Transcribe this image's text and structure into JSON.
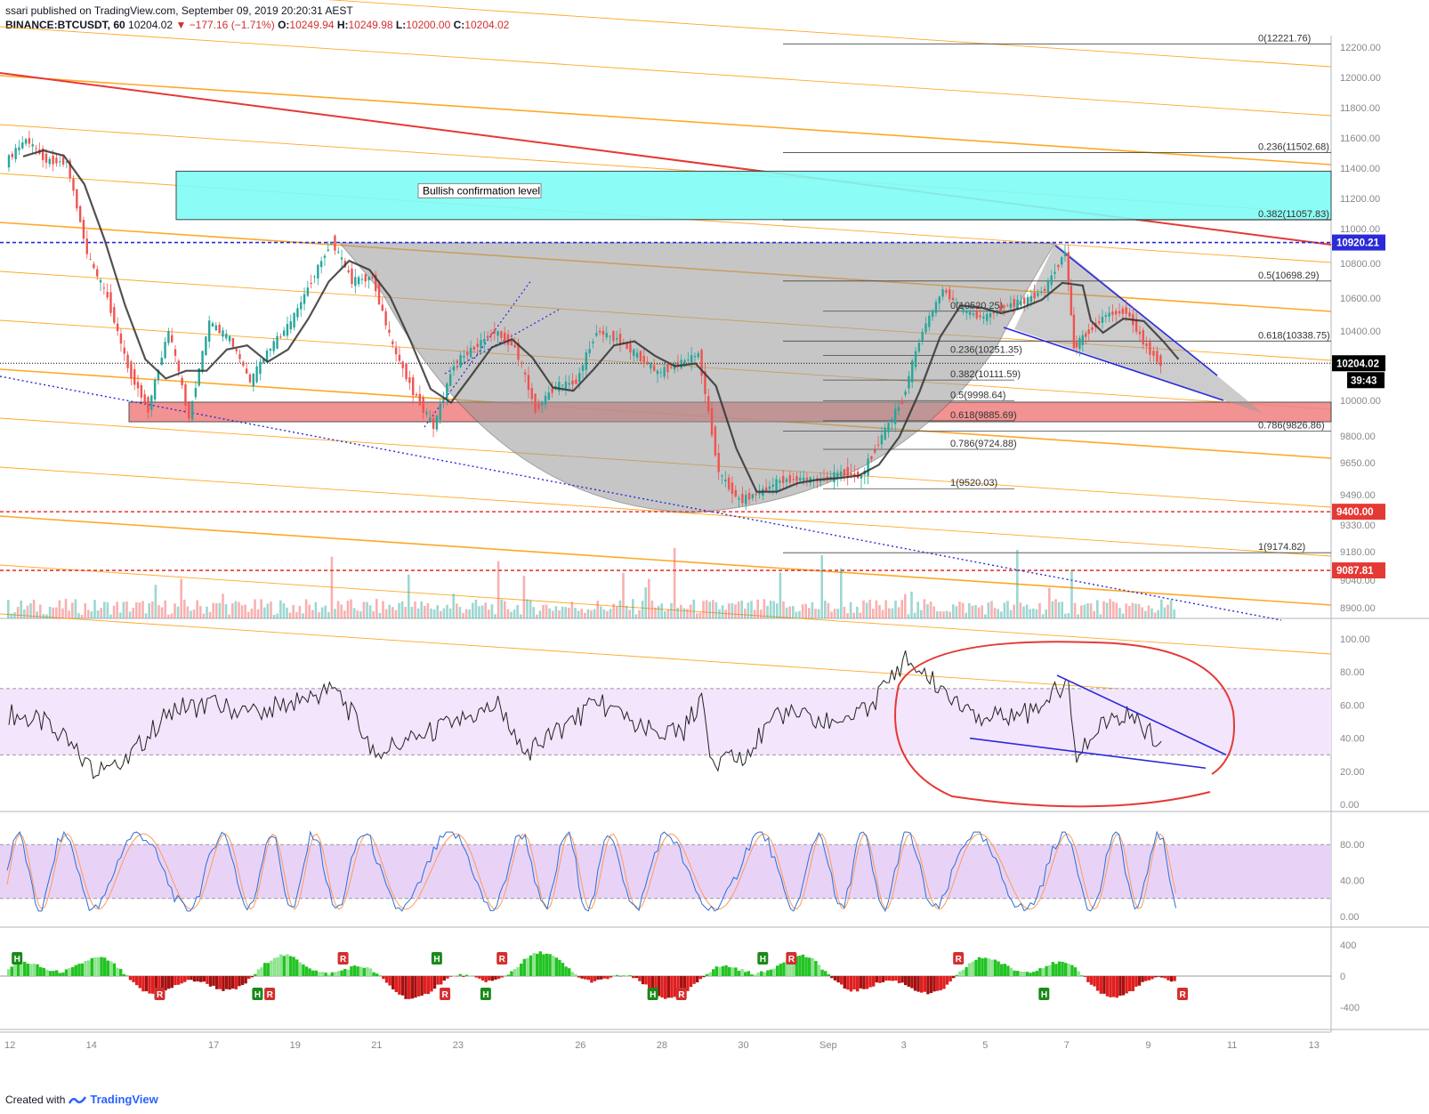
{
  "header": {
    "line1": "ssari published on TradingView.com, September 09, 2019 20:20:31 AEST",
    "symbol": "BINANCE:BTCUSDT, 60",
    "last": "10204.02",
    "change": "▼ −177.16 (−1.71%)",
    "o_label": "O:",
    "o": "10249.94",
    "h_label": "H:",
    "h": "10249.98",
    "l_label": "L:",
    "l": "10200.00",
    "c_label": "C:",
    "c": "10204.02"
  },
  "footer": {
    "created": "Created with",
    "brand": "TradingView"
  },
  "colors": {
    "up": "#26a69a",
    "down": "#ef5350",
    "fib": "#444444",
    "channel": "#ff9800",
    "resistance": "#e53935",
    "blue": "#2a2ad8",
    "rsi_band": "#f3e5fc",
    "stoch_band": "#e8d3f7",
    "cyan_zone": "#7ffcf6",
    "red_zone": "#f08080"
  },
  "chart_data": {
    "type": "line",
    "price_panel": {
      "y_ticks": [
        12200,
        12000,
        11800,
        11600,
        11400,
        11200,
        11000,
        10800,
        10600,
        10400,
        10200,
        10000,
        9800,
        9650,
        9490,
        9330,
        9180,
        9040,
        8900
      ],
      "price_badges": [
        {
          "label": "10920.21",
          "value": 10920.21,
          "color": "#2a2ad8"
        },
        {
          "label": "10204.02",
          "value": 10204.02,
          "color": "#000000"
        },
        {
          "label": "9400.00",
          "value": 9400.0,
          "color": "#e53935"
        },
        {
          "label": "9087.81",
          "value": 9087.81,
          "color": "#e53935"
        }
      ],
      "countdown": "39:43",
      "fib_right": [
        {
          "label": "0(12221.76)",
          "value": 12221.76
        },
        {
          "label": "0.236(11502.68)",
          "value": 11502.68
        },
        {
          "label": "0.382(11057.83)",
          "value": 11057.83
        },
        {
          "label": "0.5(10698.29)",
          "value": 10698.29
        },
        {
          "label": "0.618(10338.75)",
          "value": 10338.75
        },
        {
          "label": "0.786(9826.86)",
          "value": 9826.86
        },
        {
          "label": "1(9174.82)",
          "value": 9174.82
        }
      ],
      "fib_inner": [
        {
          "label": "0(10520.25)",
          "value": 10520.25
        },
        {
          "label": "0.236(10251.35)",
          "value": 10251.35
        },
        {
          "label": "0.382(10111.59)",
          "value": 10111.59
        },
        {
          "label": "0.5(9998.64)",
          "value": 9998.64
        },
        {
          "label": "0.618(9885.69)",
          "value": 9885.69
        },
        {
          "label": "0.786(9724.88)",
          "value": 9724.88
        },
        {
          "label": "1(9520.03)",
          "value": 9520.03
        }
      ],
      "zones": [
        {
          "label": "Bullish confirmation level",
          "from": 11060,
          "to": 11380
        },
        {
          "label": "",
          "from": 9880,
          "to": 9990
        }
      ],
      "price_path": [
        {
          "x": 0,
          "y": 11440
        },
        {
          "x": 0.5,
          "y": 11590
        },
        {
          "x": 1,
          "y": 11450
        },
        {
          "x": 1.5,
          "y": 11440
        },
        {
          "x": 2,
          "y": 10850
        },
        {
          "x": 2.5,
          "y": 10600
        },
        {
          "x": 3,
          "y": 10180
        },
        {
          "x": 3.5,
          "y": 9950
        },
        {
          "x": 4,
          "y": 10400
        },
        {
          "x": 4.5,
          "y": 9900
        },
        {
          "x": 5,
          "y": 10450
        },
        {
          "x": 5.5,
          "y": 10350
        },
        {
          "x": 6,
          "y": 10100
        },
        {
          "x": 6.5,
          "y": 10300
        },
        {
          "x": 7,
          "y": 10450
        },
        {
          "x": 7.5,
          "y": 10700
        },
        {
          "x": 8,
          "y": 10930
        },
        {
          "x": 8.5,
          "y": 10700
        },
        {
          "x": 9,
          "y": 10720
        },
        {
          "x": 9.5,
          "y": 10300
        },
        {
          "x": 10,
          "y": 10050
        },
        {
          "x": 10.5,
          "y": 9850
        },
        {
          "x": 11,
          "y": 10200
        },
        {
          "x": 11.5,
          "y": 10300
        },
        {
          "x": 12,
          "y": 10400
        },
        {
          "x": 12.5,
          "y": 10300
        },
        {
          "x": 13,
          "y": 9950
        },
        {
          "x": 13.5,
          "y": 10080
        },
        {
          "x": 14,
          "y": 10100
        },
        {
          "x": 14.5,
          "y": 10400
        },
        {
          "x": 15,
          "y": 10350
        },
        {
          "x": 15.5,
          "y": 10250
        },
        {
          "x": 16,
          "y": 10150
        },
        {
          "x": 16.5,
          "y": 10200
        },
        {
          "x": 17,
          "y": 10260
        },
        {
          "x": 17.5,
          "y": 9600
        },
        {
          "x": 18,
          "y": 9460
        },
        {
          "x": 18.5,
          "y": 9500
        },
        {
          "x": 19,
          "y": 9560
        },
        {
          "x": 19.5,
          "y": 9570
        },
        {
          "x": 20,
          "y": 9560
        },
        {
          "x": 20.5,
          "y": 9600
        },
        {
          "x": 21,
          "y": 9580
        },
        {
          "x": 21.5,
          "y": 9800
        },
        {
          "x": 22,
          "y": 10000
        },
        {
          "x": 22.5,
          "y": 10400
        },
        {
          "x": 23,
          "y": 10650
        },
        {
          "x": 23.5,
          "y": 10520
        },
        {
          "x": 24,
          "y": 10480
        },
        {
          "x": 24.5,
          "y": 10550
        },
        {
          "x": 25,
          "y": 10580
        },
        {
          "x": 25.5,
          "y": 10650
        },
        {
          "x": 26,
          "y": 10870
        },
        {
          "x": 26.2,
          "y": 10300
        },
        {
          "x": 26.5,
          "y": 10380
        },
        {
          "x": 27,
          "y": 10500
        },
        {
          "x": 27.5,
          "y": 10520
        },
        {
          "x": 28,
          "y": 10300
        },
        {
          "x": 28.35,
          "y": 10204.02
        }
      ],
      "day_labels": [
        {
          "x": 0,
          "label": "12"
        },
        {
          "x": 2,
          "label": "14"
        },
        {
          "x": 5,
          "label": "17"
        },
        {
          "x": 7,
          "label": "19"
        },
        {
          "x": 9,
          "label": "21"
        },
        {
          "x": 11,
          "label": "23"
        },
        {
          "x": 14,
          "label": "26"
        },
        {
          "x": 16,
          "label": "28"
        },
        {
          "x": 18,
          "label": "30"
        },
        {
          "x": 20,
          "label": "Sep"
        },
        {
          "x": 22,
          "label": "3"
        },
        {
          "x": 24,
          "label": "5"
        },
        {
          "x": 26,
          "label": "7"
        },
        {
          "x": 28,
          "label": "9"
        },
        {
          "x": 30,
          "label": "11"
        },
        {
          "x": 32,
          "label": "13"
        }
      ]
    },
    "rsi_panel": {
      "y_ticks": [
        100,
        80,
        60,
        40,
        20,
        0
      ],
      "band": [
        30,
        70
      ],
      "values": [
        {
          "x": 0,
          "y": 55
        },
        {
          "x": 1,
          "y": 48
        },
        {
          "x": 2,
          "y": 22
        },
        {
          "x": 3,
          "y": 30
        },
        {
          "x": 4,
          "y": 58
        },
        {
          "x": 5,
          "y": 60
        },
        {
          "x": 6,
          "y": 55
        },
        {
          "x": 7,
          "y": 62
        },
        {
          "x": 8,
          "y": 70
        },
        {
          "x": 9,
          "y": 32
        },
        {
          "x": 10,
          "y": 40
        },
        {
          "x": 11,
          "y": 50
        },
        {
          "x": 12,
          "y": 60
        },
        {
          "x": 12.6,
          "y": 30
        },
        {
          "x": 13.5,
          "y": 45
        },
        {
          "x": 14.5,
          "y": 62
        },
        {
          "x": 15.5,
          "y": 45
        },
        {
          "x": 16.5,
          "y": 42
        },
        {
          "x": 17,
          "y": 65
        },
        {
          "x": 17.2,
          "y": 22
        },
        {
          "x": 18,
          "y": 30
        },
        {
          "x": 19,
          "y": 55
        },
        {
          "x": 20,
          "y": 50
        },
        {
          "x": 21,
          "y": 55
        },
        {
          "x": 22,
          "y": 88
        },
        {
          "x": 23,
          "y": 68
        },
        {
          "x": 24,
          "y": 52
        },
        {
          "x": 25,
          "y": 55
        },
        {
          "x": 26,
          "y": 74
        },
        {
          "x": 26.2,
          "y": 32
        },
        {
          "x": 27,
          "y": 50
        },
        {
          "x": 27.5,
          "y": 55
        },
        {
          "x": 28,
          "y": 42
        },
        {
          "x": 28.35,
          "y": 36
        }
      ]
    },
    "stoch_panel": {
      "y_ticks": [
        80,
        40,
        0
      ],
      "band": [
        20,
        80
      ]
    },
    "macd_panel": {
      "y_ticks": [
        400,
        0,
        -400
      ],
      "markers": [
        {
          "x": 0.2,
          "label": "H",
          "side": "up"
        },
        {
          "x": 3.7,
          "label": "R",
          "side": "down"
        },
        {
          "x": 6.1,
          "label": "H",
          "side": "down"
        },
        {
          "x": 6.4,
          "label": "R",
          "side": "down"
        },
        {
          "x": 8.2,
          "label": "R",
          "side": "up"
        },
        {
          "x": 10.5,
          "label": "H",
          "side": "up"
        },
        {
          "x": 10.7,
          "label": "R",
          "side": "down"
        },
        {
          "x": 11.7,
          "label": "H",
          "side": "down"
        },
        {
          "x": 12.1,
          "label": "R",
          "side": "up"
        },
        {
          "x": 15.8,
          "label": "H",
          "side": "down"
        },
        {
          "x": 16.5,
          "label": "R",
          "side": "down"
        },
        {
          "x": 18.5,
          "label": "H",
          "side": "up"
        },
        {
          "x": 19.2,
          "label": "R",
          "side": "up"
        },
        {
          "x": 23.3,
          "label": "R",
          "side": "up"
        },
        {
          "x": 25.4,
          "label": "H",
          "side": "down"
        },
        {
          "x": 28.8,
          "label": "R",
          "side": "down"
        }
      ]
    }
  }
}
